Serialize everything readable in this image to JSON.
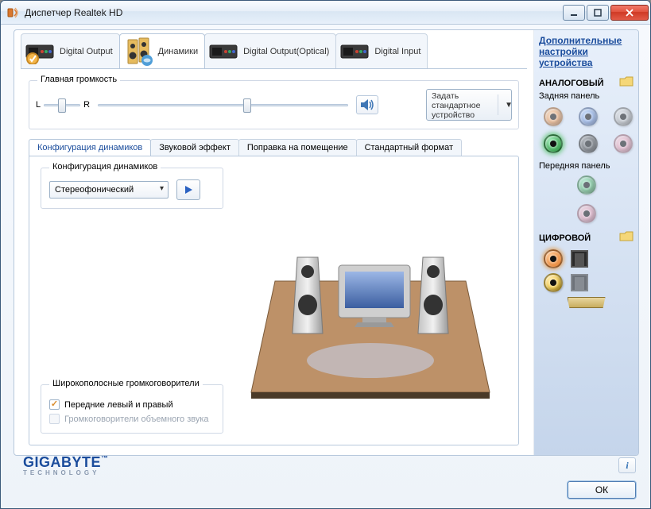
{
  "window": {
    "title": "Диспетчер Realtek HD"
  },
  "device_tabs": [
    {
      "label": "Digital Output"
    },
    {
      "label": "Динамики"
    },
    {
      "label": "Digital Output(Optical)"
    },
    {
      "label": "Digital Input"
    }
  ],
  "volume": {
    "legend": "Главная громкость",
    "left": "L",
    "right": "R",
    "default_btn": "Задать стандартное устройство"
  },
  "inner_tabs": [
    "Конфигурация динамиков",
    "Звуковой эффект",
    "Поправка на помещение",
    "Стандартный формат"
  ],
  "config": {
    "legend": "Конфигурация динамиков",
    "selected": "Стереофонический"
  },
  "fullrange": {
    "legend": "Широкополосные громкоговорители",
    "front": "Передние левый и правый",
    "surround": "Громкоговорители объемного звука"
  },
  "right": {
    "adv_link": "Дополнительные настройки устройства",
    "analog": "АНАЛОГОВЫЙ",
    "rear": "Задняя панель",
    "front": "Передняя панель",
    "digital": "ЦИФРОВОЙ"
  },
  "footer": {
    "logo1": "GIGABYTE",
    "logo_tm": "™",
    "logo2": "TECHNOLOGY",
    "ok": "ОК"
  },
  "icons": {
    "info": "i"
  }
}
